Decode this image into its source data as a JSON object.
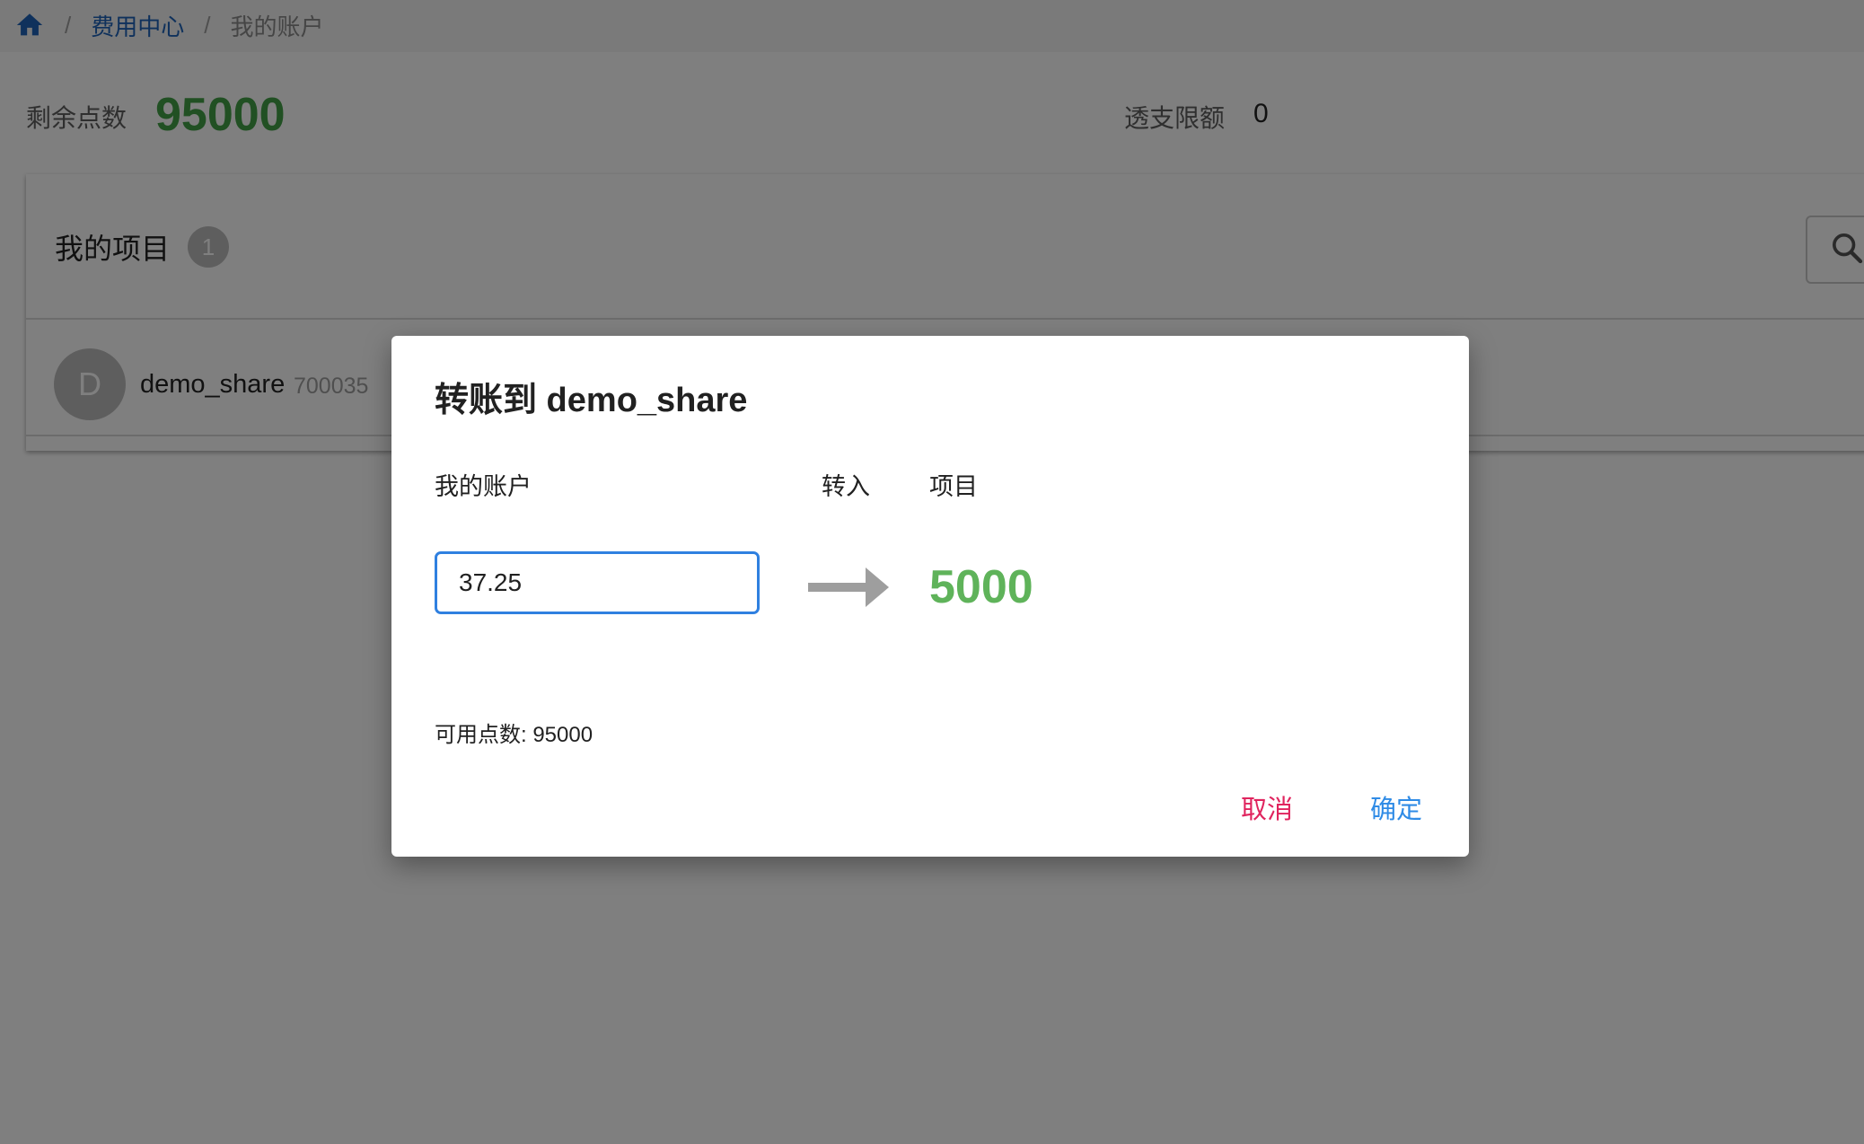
{
  "breadcrumb": {
    "home_icon": "home-icon",
    "items": [
      "费用中心",
      "我的账户"
    ],
    "link_color": "#1e63b8"
  },
  "stats": {
    "remaining_label": "剩余点数",
    "remaining_value": "95000",
    "overdraft_label": "透支限额",
    "overdraft_value": "0"
  },
  "projects": {
    "title": "我的项目",
    "count": "1",
    "search_icon": "search-icon",
    "items": [
      {
        "avatar": "D",
        "name": "demo_share",
        "id": "700035"
      }
    ]
  },
  "dialog": {
    "title": "转账到 demo_share",
    "from_label": "我的账户",
    "direction_label": "转入",
    "to_label": "项目",
    "amount_value": "37.25",
    "target_value": "5000",
    "available": "可用点数: 95000",
    "cancel_label": "取消",
    "confirm_label": "确定",
    "colors": {
      "input_border": "#2f80e0",
      "target": "#5fb35a",
      "cancel": "#e0245e",
      "confirm": "#2f8be6"
    }
  }
}
